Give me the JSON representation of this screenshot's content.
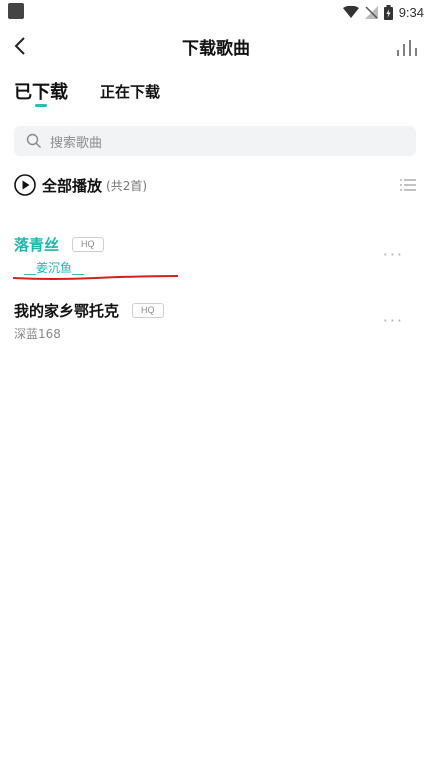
{
  "statusbar": {
    "time": "9:34"
  },
  "header": {
    "title": "下载歌曲"
  },
  "tabs": [
    {
      "label": "已下载",
      "active": true
    },
    {
      "label": "正在下载",
      "active": false
    }
  ],
  "search": {
    "placeholder": "搜索歌曲"
  },
  "play_all": {
    "label": "全部播放",
    "count": "(共2首)"
  },
  "songs": [
    {
      "title": "落青丝",
      "quality": "HQ",
      "artist_prefix": "__",
      "artist": "姜沉鱼",
      "artist_suffix": "__",
      "more": "···"
    },
    {
      "title": "我的家乡鄂托克",
      "quality": "HQ",
      "artist": "深蓝168",
      "more": "···"
    }
  ],
  "colors": {
    "accent": "#1cb8ad",
    "annotation": "#d62020"
  }
}
